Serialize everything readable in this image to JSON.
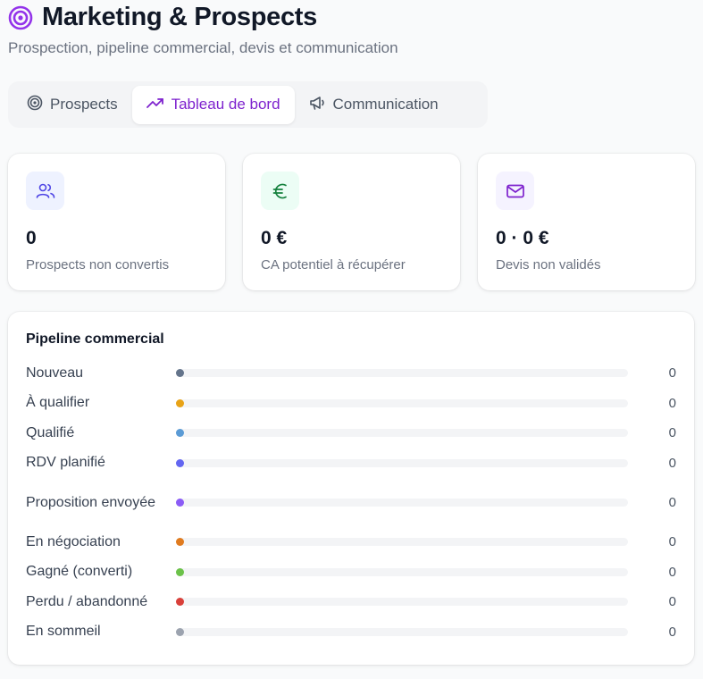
{
  "header": {
    "title": "Marketing & Prospects",
    "subtitle": "Prospection, pipeline commercial, devis et communication",
    "icon": "target-icon",
    "accent": "#9333ea"
  },
  "tabs": [
    {
      "label": "Prospects",
      "icon": "target-icon",
      "active": false
    },
    {
      "label": "Tableau de bord",
      "icon": "trending-up-icon",
      "active": true
    },
    {
      "label": "Communication",
      "icon": "megaphone-icon",
      "active": false
    }
  ],
  "stats": [
    {
      "value": "0",
      "label": "Prospects non convertis",
      "icon": "users-icon",
      "icon_color": "#4f46e5",
      "icon_bg": "#eef2ff"
    },
    {
      "value": "0 €",
      "label": "CA potentiel à récupérer",
      "icon": "euro-icon",
      "icon_color": "#15803d",
      "icon_bg": "#ecfdf5"
    },
    {
      "value": "0 · 0 €",
      "label": "Devis non validés",
      "icon": "mail-icon",
      "icon_color": "#7e22ce",
      "icon_bg": "#f5f3ff"
    }
  ],
  "pipeline": {
    "title": "Pipeline commercial",
    "stages": [
      {
        "name": "Nouveau",
        "count": "0",
        "color": "#64748b",
        "fill": 0
      },
      {
        "name": "À qualifier",
        "count": "0",
        "color": "#e8a317",
        "fill": 0
      },
      {
        "name": "Qualifié",
        "count": "0",
        "color": "#5b9bd5",
        "fill": 0
      },
      {
        "name": "RDV planifié",
        "count": "0",
        "color": "#6366f1",
        "fill": 0
      },
      {
        "name": "Proposition envoyée",
        "count": "0",
        "color": "#8b5cf6",
        "fill": 0
      },
      {
        "name": "En négociation",
        "count": "0",
        "color": "#e07b1f",
        "fill": 0
      },
      {
        "name": "Gagné (converti)",
        "count": "0",
        "color": "#6cc24a",
        "fill": 0
      },
      {
        "name": "Perdu / abandonné",
        "count": "0",
        "color": "#d9403a",
        "fill": 0
      },
      {
        "name": "En sommeil",
        "count": "0",
        "color": "#9ca3af",
        "fill": 0
      }
    ]
  }
}
